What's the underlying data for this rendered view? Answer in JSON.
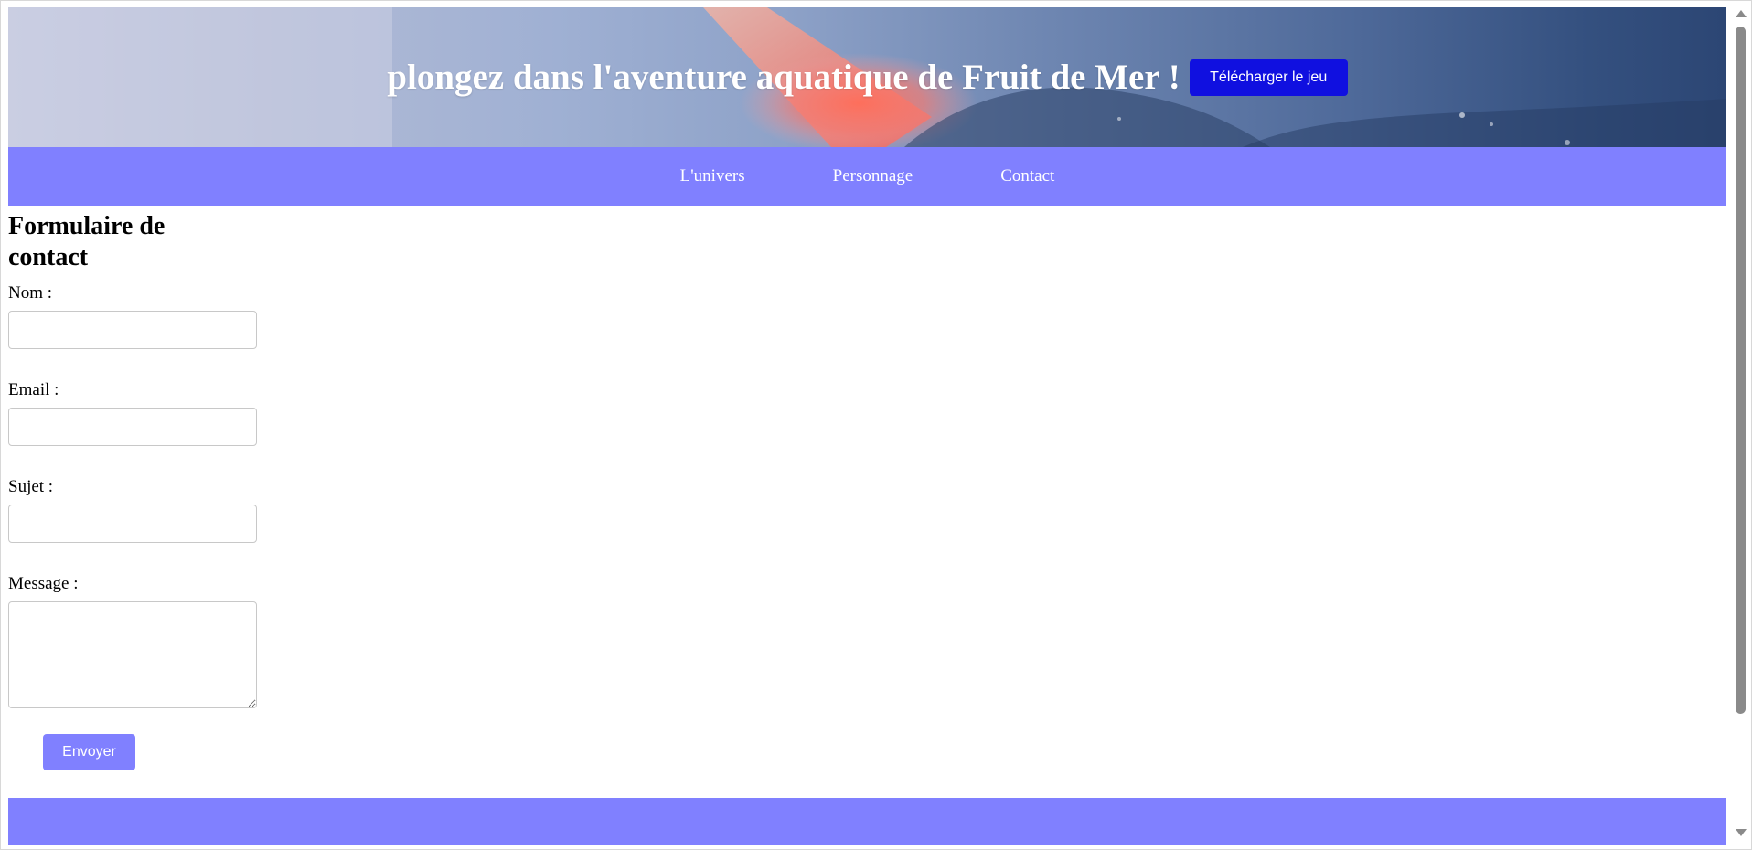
{
  "banner": {
    "title": "plongez dans l'aventure aquatique de Fruit de Mer !",
    "download_label": "Télécharger le jeu"
  },
  "nav": {
    "items": [
      {
        "label": "L'univers"
      },
      {
        "label": "Personnage"
      },
      {
        "label": "Contact"
      }
    ]
  },
  "form": {
    "title": "Formulaire de contact",
    "fields": {
      "name": {
        "label": "Nom :",
        "value": ""
      },
      "email": {
        "label": "Email :",
        "value": ""
      },
      "subject": {
        "label": "Sujet :",
        "value": ""
      },
      "message": {
        "label": "Message :",
        "value": ""
      }
    },
    "submit_label": "Envoyer"
  },
  "colors": {
    "accent": "#8080ff",
    "download_button": "#1010e0",
    "text": "#000000"
  },
  "icons": {
    "scroll_up": "triangle-up-icon",
    "scroll_down": "triangle-down-icon"
  }
}
